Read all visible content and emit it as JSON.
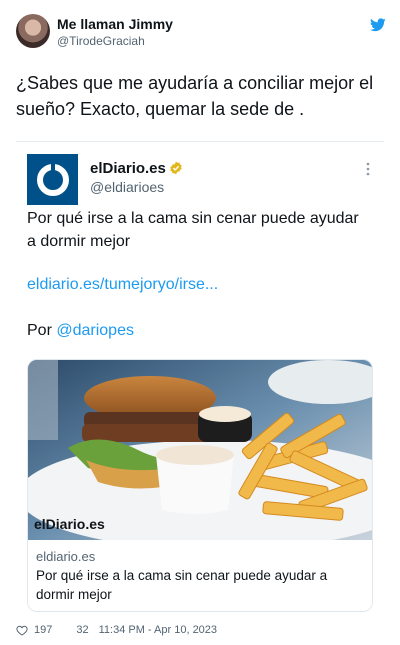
{
  "author": {
    "name": "Me llaman Jimmy",
    "handle": "@TirodeGraciah"
  },
  "tweet": {
    "text": "¿Sabes que me ayudaría a conciliar mejor el sueño? Exacto, quemar la sede de ."
  },
  "quoted": {
    "name": "elDiario.es",
    "handle": "@eldiarioes",
    "text": "Por qué irse a la cama sin cenar puede ayudar a dormir mejor",
    "link": "eldiario.es/tumejoryo/irse...",
    "byline_prefix": "Por",
    "byline_mention": "@dariopes",
    "card": {
      "image_logo": "elDiario.es",
      "domain": "eldiario.es",
      "title": "Por qué irse a la cama sin cenar puede ayudar a dormir mejor"
    }
  },
  "footer": {
    "likes": "197",
    "replies": "32",
    "timestamp": "11:34 PM - Apr 10, 2023"
  },
  "colors": {
    "accent": "#1d9bf0",
    "brand_blue": "#00518a"
  },
  "icons": [
    "avatar",
    "twitter-bird-icon",
    "verified-icon",
    "more-icon",
    "heart-icon"
  ]
}
